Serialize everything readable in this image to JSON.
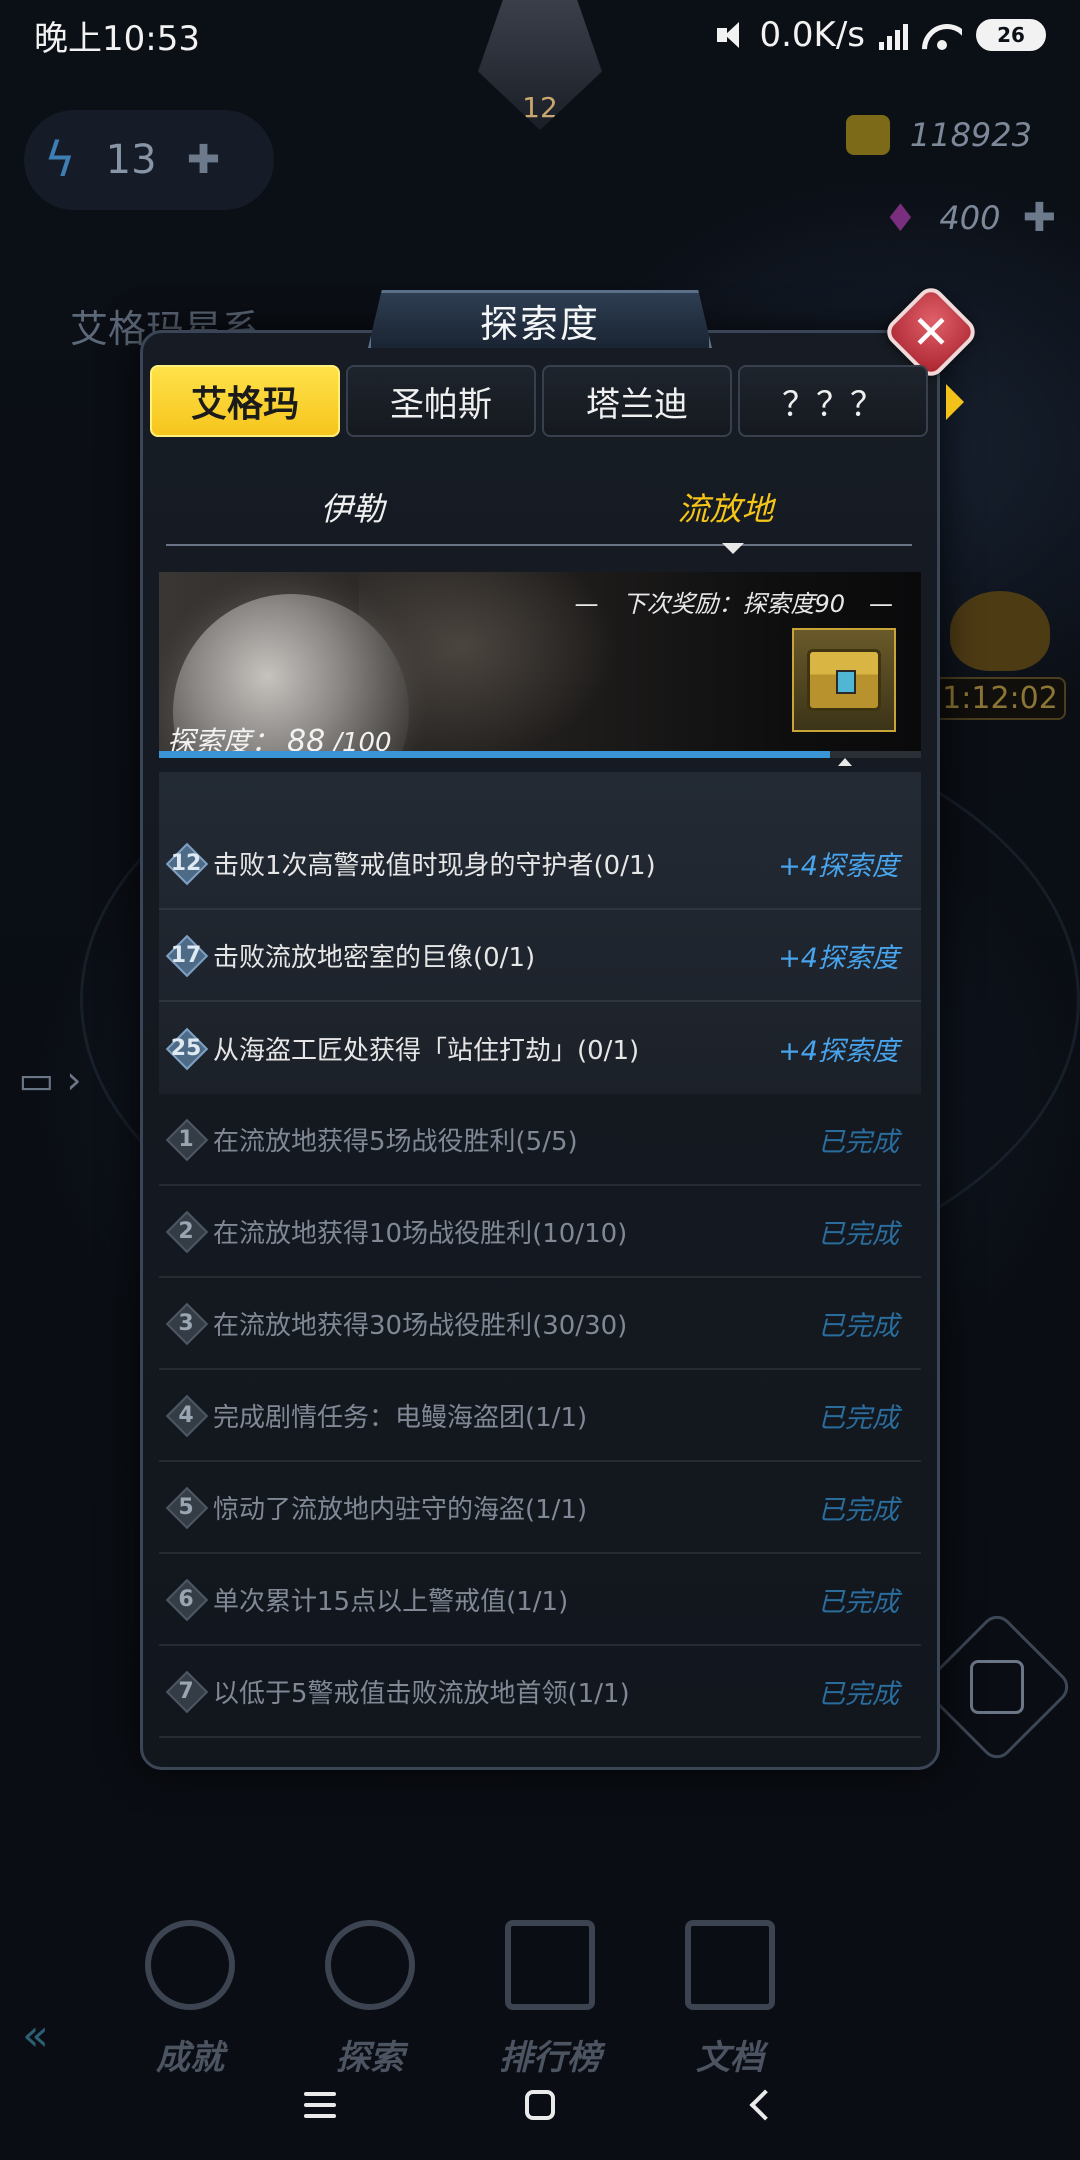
{
  "status_bar": {
    "time": "晚上10:53",
    "network_speed": "0.0K/s",
    "battery": "26"
  },
  "background": {
    "energy_value": "13",
    "player_level": "12",
    "gold": "118923",
    "gems": "400",
    "system_title": "艾格玛星系",
    "timer": "1:12:02",
    "nav": [
      "成就",
      "探索",
      "排行榜",
      "文档"
    ]
  },
  "modal": {
    "title": "探索度",
    "tabs": [
      "艾格玛",
      "圣帕斯",
      "塔兰迪",
      "？？？"
    ],
    "active_tab": 0,
    "subtabs": [
      "伊勒",
      "流放地"
    ],
    "active_subtab": 1,
    "banner": {
      "next_reward": "—　下次奖励：探索度90　—",
      "explore_label": "探索度：",
      "explore_value": "88",
      "explore_max": "/100",
      "progress_fraction": 0.88
    },
    "pending_tasks": [
      {
        "num": "12",
        "name": "击败1次高警戒值时现身的守护者(0/1)",
        "reward": "+4探索度"
      },
      {
        "num": "17",
        "name": "击败流放地密室的巨像(0/1)",
        "reward": "+4探索度"
      },
      {
        "num": "25",
        "name": "从海盗工匠处获得「站住打劫」(0/1)",
        "reward": "+4探索度"
      }
    ],
    "completed_tasks": [
      {
        "num": "1",
        "name": "在流放地获得5场战役胜利(5/5)",
        "reward": "已完成"
      },
      {
        "num": "2",
        "name": "在流放地获得10场战役胜利(10/10)",
        "reward": "已完成"
      },
      {
        "num": "3",
        "name": "在流放地获得30场战役胜利(30/30)",
        "reward": "已完成"
      },
      {
        "num": "4",
        "name": "完成剧情任务：电鳗海盗团(1/1)",
        "reward": "已完成"
      },
      {
        "num": "5",
        "name": "惊动了流放地内驻守的海盗(1/1)",
        "reward": "已完成"
      },
      {
        "num": "6",
        "name": "单次累计15点以上警戒值(1/1)",
        "reward": "已完成"
      },
      {
        "num": "7",
        "name": "以低于5警戒值击败流放地首领(1/1)",
        "reward": "已完成"
      }
    ]
  }
}
